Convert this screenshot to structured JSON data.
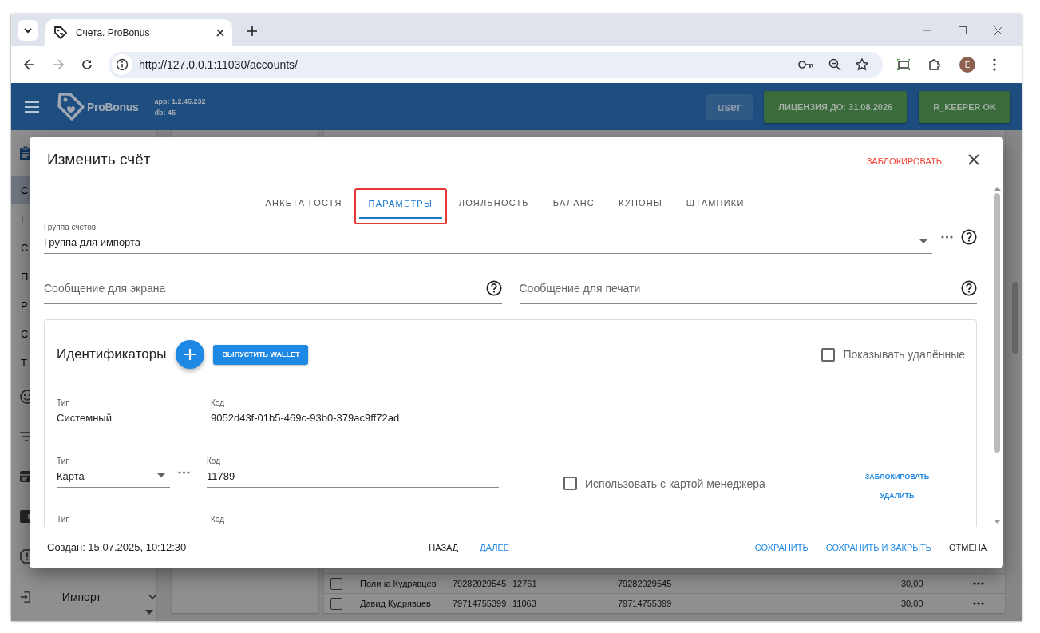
{
  "browser": {
    "tab_title": "Счета. ProBonus",
    "url": "http://127.0.0.1:11030/accounts/",
    "profile_initial": "E"
  },
  "app_header": {
    "brand": "ProBonus",
    "app_version": "app: 1.2.45.232",
    "db_version": "db: 45",
    "user": "user",
    "license": "ЛИЦЕНЗИЯ ДО: 31.08.2026",
    "rkeeper": "R_KEEPER OK"
  },
  "sidebar": {
    "items": [
      {
        "label": "С",
        "selected": true
      },
      {
        "label": "Г",
        "selected": false
      },
      {
        "label": "С",
        "selected": false
      },
      {
        "label": "П",
        "selected": false
      },
      {
        "label": "Р",
        "selected": false
      },
      {
        "label": "С",
        "selected": false
      },
      {
        "label": "Т",
        "selected": false
      }
    ],
    "import_label": "Импорт"
  },
  "table": {
    "rows": [
      {
        "column_1": "Полина Кудрявцев",
        "column_2": "79282029545",
        "column_3": "12761",
        "column_4": "79282029545",
        "column_5": "30,00",
        "checked": false
      },
      {
        "column_1": "Давид Кудрявцев",
        "column_2": "79714755399",
        "column_3": "11063",
        "column_4": "79714755399",
        "column_5": "30,00",
        "checked": false
      }
    ]
  },
  "dialog": {
    "title": "Изменить счёт",
    "block_action": "ЗАБЛОКИРОВАТЬ",
    "tabs": [
      {
        "label": "АНКЕТА ГОСТЯ",
        "selected": false,
        "annotated": false
      },
      {
        "label": "ПАРАМЕТРЫ",
        "selected": true,
        "annotated": true
      },
      {
        "label": "ЛОЯЛЬНОСТЬ",
        "selected": false,
        "annotated": false
      },
      {
        "label": "БАЛАНС",
        "selected": false,
        "annotated": false
      },
      {
        "label": "КУПОНЫ",
        "selected": false,
        "annotated": false
      },
      {
        "label": "ШТАМПИКИ",
        "selected": false,
        "annotated": false
      }
    ],
    "account_group": {
      "label": "Группа счетов",
      "value": "Группа для импорта"
    },
    "messages": [
      {
        "placeholder": "Сообщение для экрана"
      },
      {
        "placeholder": "Сообщение для печати"
      }
    ],
    "identifiers": {
      "title": "Идентификаторы",
      "issue_button": "ВЫПУСТИТЬ WALLET",
      "show_deleted": {
        "label": "Показывать удалённые",
        "checked": false
      },
      "rows": [
        {
          "kind": "text",
          "type_label": "Тип",
          "type_value": "Системный",
          "code_label": "Код",
          "code_value": "9052d43f-01b5-469c-93b0-379ac9ff72ad"
        },
        {
          "kind": "select",
          "type_label": "Тип",
          "type_value": "Карта",
          "code_label": "Код",
          "code_value": "11789",
          "manager_card": {
            "label": "Использовать с картой менеджера",
            "checked": false
          },
          "actions": [
            "ЗАБЛОКИРОВАТЬ",
            "УДАЛИТЬ"
          ]
        },
        {
          "kind": "text",
          "type_label": "Тип",
          "code_label": "Код"
        }
      ]
    },
    "created": "Создан: 15.07.2025, 10:12:30",
    "nav_buttons": [
      {
        "label": "НАЗАД",
        "kind": "default"
      },
      {
        "label": "ДАЛЕЕ",
        "kind": "primary"
      }
    ],
    "action_buttons": [
      {
        "label": "СОХРАНИТЬ",
        "kind": "primary"
      },
      {
        "label": "СОХРАНИТЬ И ЗАКРЫТЬ",
        "kind": "primary"
      },
      {
        "label": "ОТМЕНА",
        "kind": "default"
      }
    ]
  }
}
